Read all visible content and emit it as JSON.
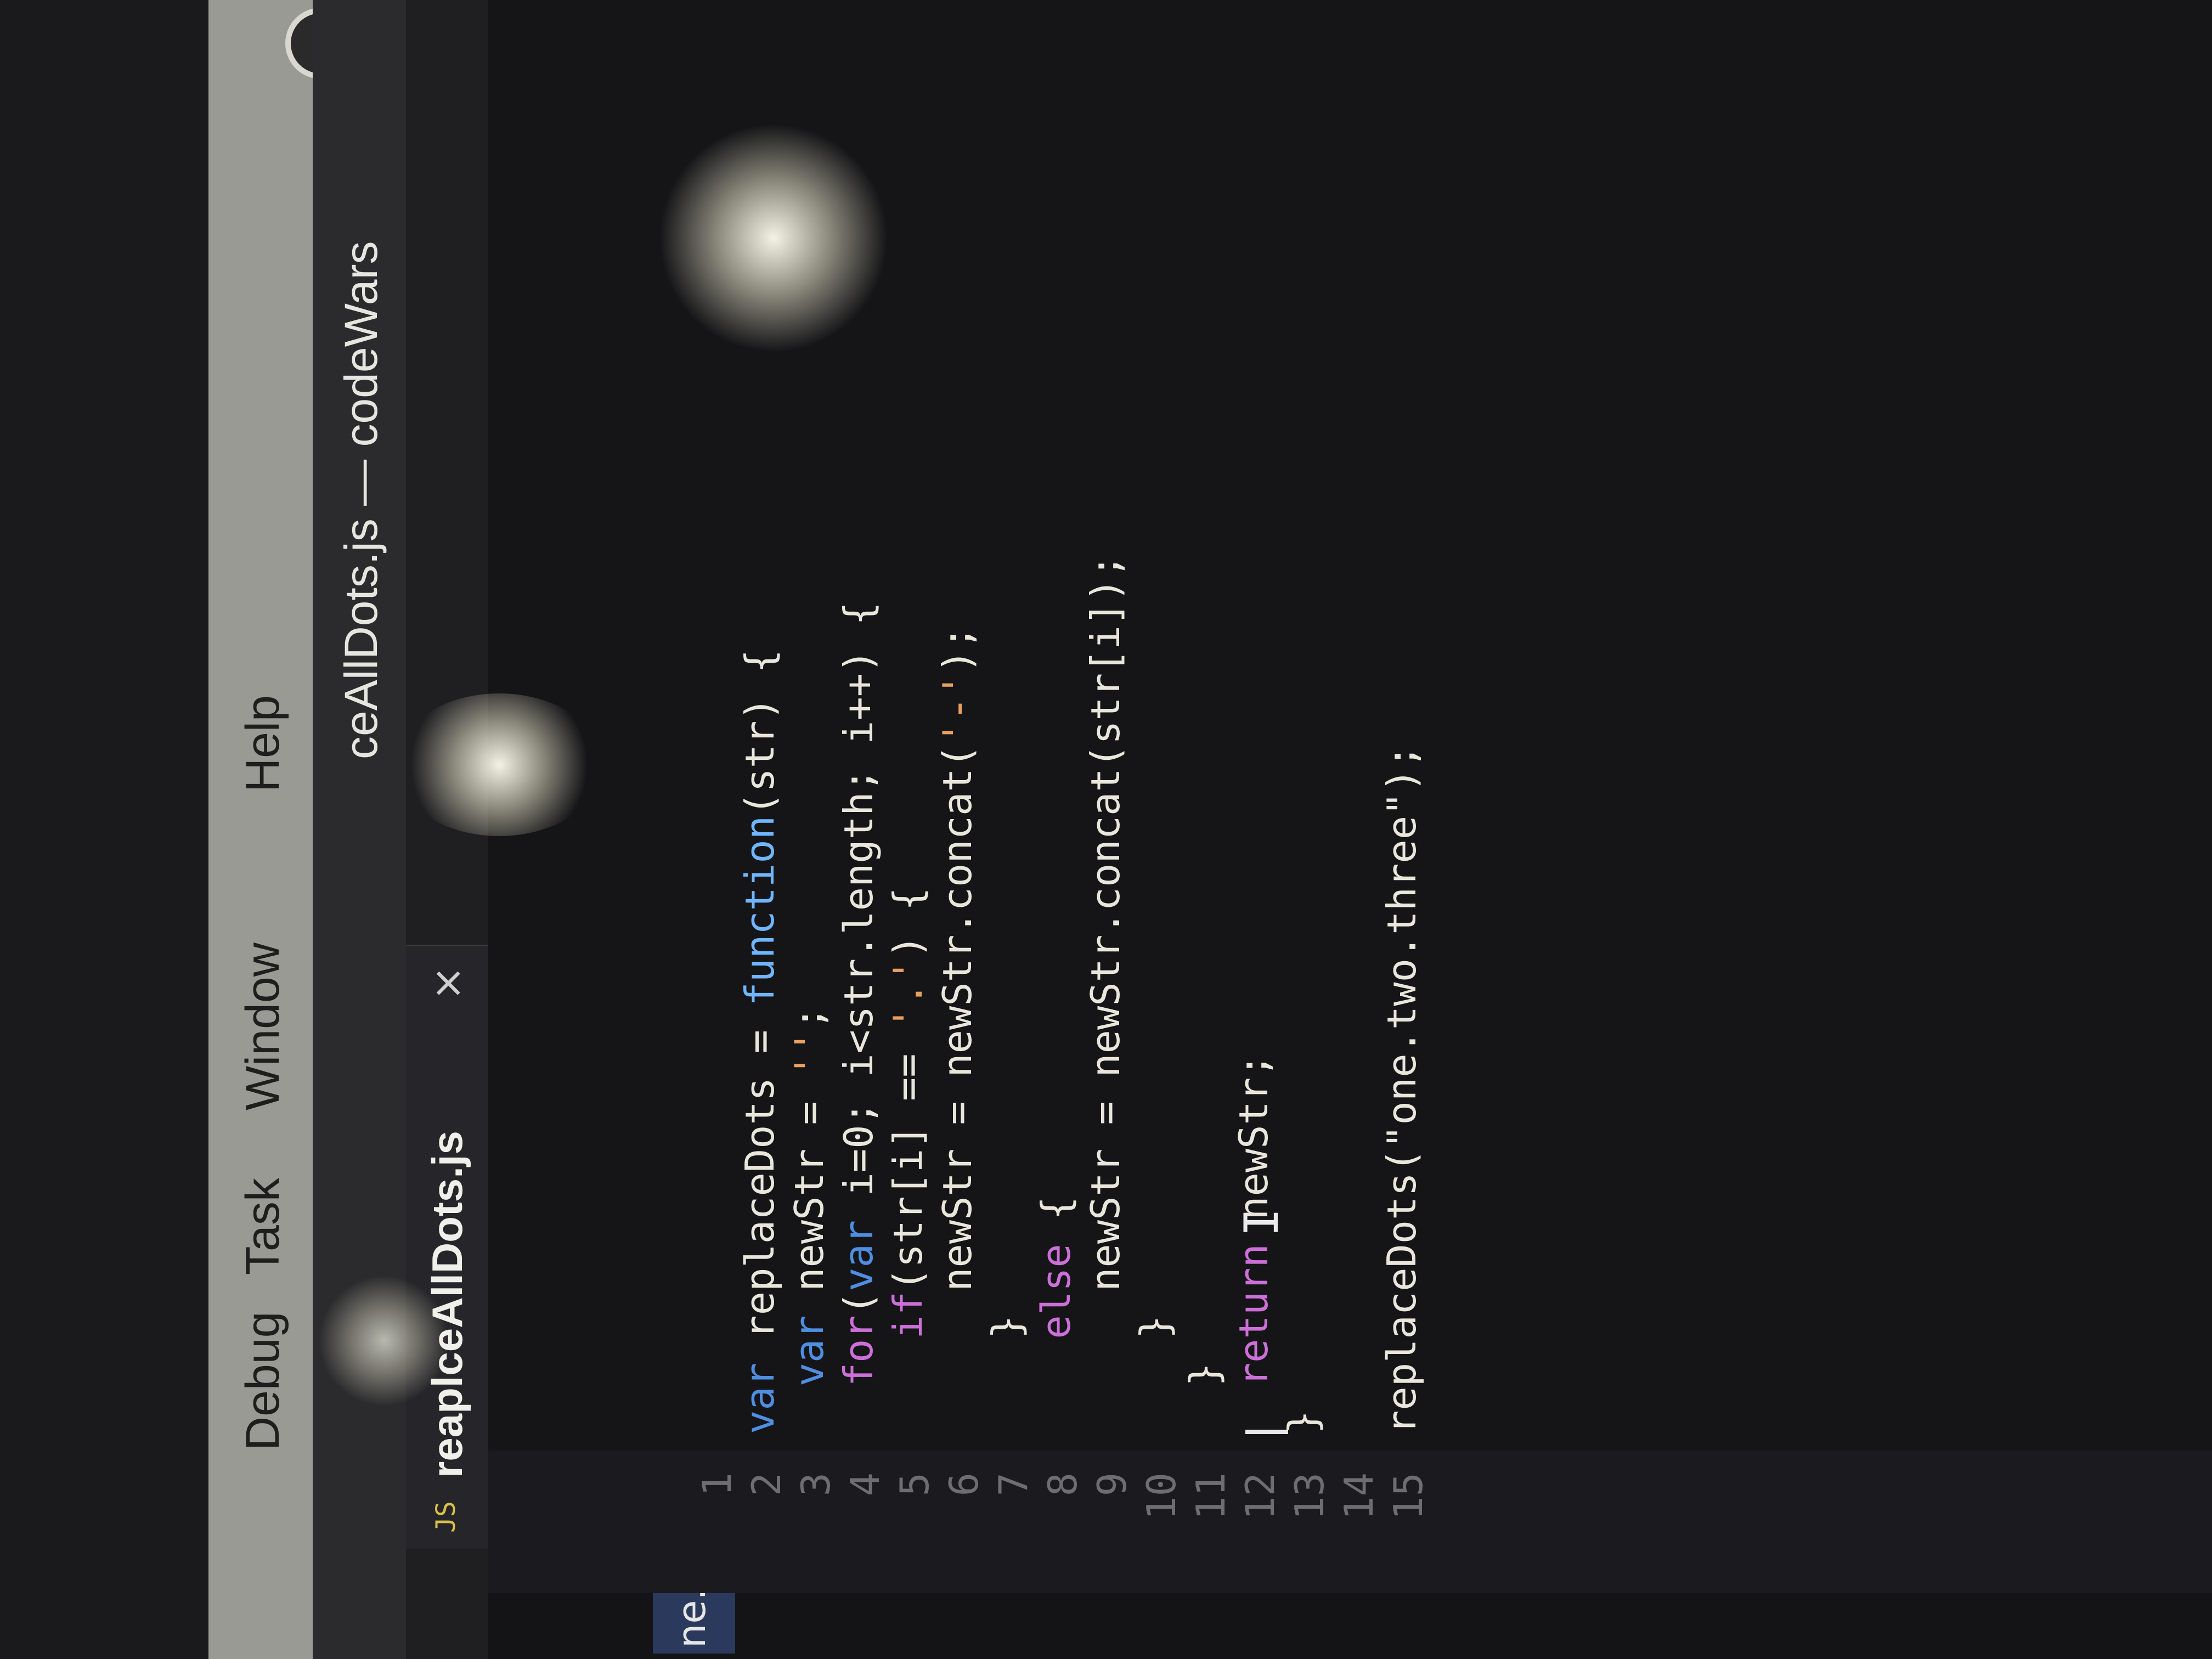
{
  "menubar": {
    "items": [
      "Debug",
      "Task",
      "Window",
      "Help"
    ]
  },
  "titlebar": {
    "title": "ceAllDots.js — codeWars"
  },
  "tab": {
    "badge": "JS",
    "label": "reaplceAllDots.js",
    "close": "×"
  },
  "sidebar": {
    "item_label": "ne..."
  },
  "editor": {
    "lines": [
      {
        "n": "1",
        "text": "var replaceDots = function(str) {"
      },
      {
        "n": "2",
        "text": "  var newStr = '';"
      },
      {
        "n": "3",
        "text": "  for(var i=0; i<str.length; i++) {"
      },
      {
        "n": "4",
        "text": "    if(str[i] == '.') {"
      },
      {
        "n": "5",
        "text": "      newStr = newStr.concat('-');"
      },
      {
        "n": "6",
        "text": "    }"
      },
      {
        "n": "7",
        "text": "    else {"
      },
      {
        "n": "8",
        "text": "      newStr = newStr.concat(str[i]);"
      },
      {
        "n": "9",
        "text": "    }"
      },
      {
        "n": "10",
        "text": "  }"
      },
      {
        "n": "11",
        "text": "  return newStr;"
      },
      {
        "n": "12",
        "text": "}"
      },
      {
        "n": "13",
        "text": ""
      },
      {
        "n": "14",
        "text": "replaceDots(\"one.two.three\");"
      },
      {
        "n": "15",
        "text": ""
      }
    ]
  },
  "colors": {
    "keyword": "#4f8ee0",
    "control": "#cc70d8",
    "function": "#6fb6ff",
    "string": "#e8a060",
    "text": "#e9e6dc"
  },
  "icons": {
    "cloud": "creative-cloud-icon",
    "cursor": "text-ibeam-cursor"
  }
}
